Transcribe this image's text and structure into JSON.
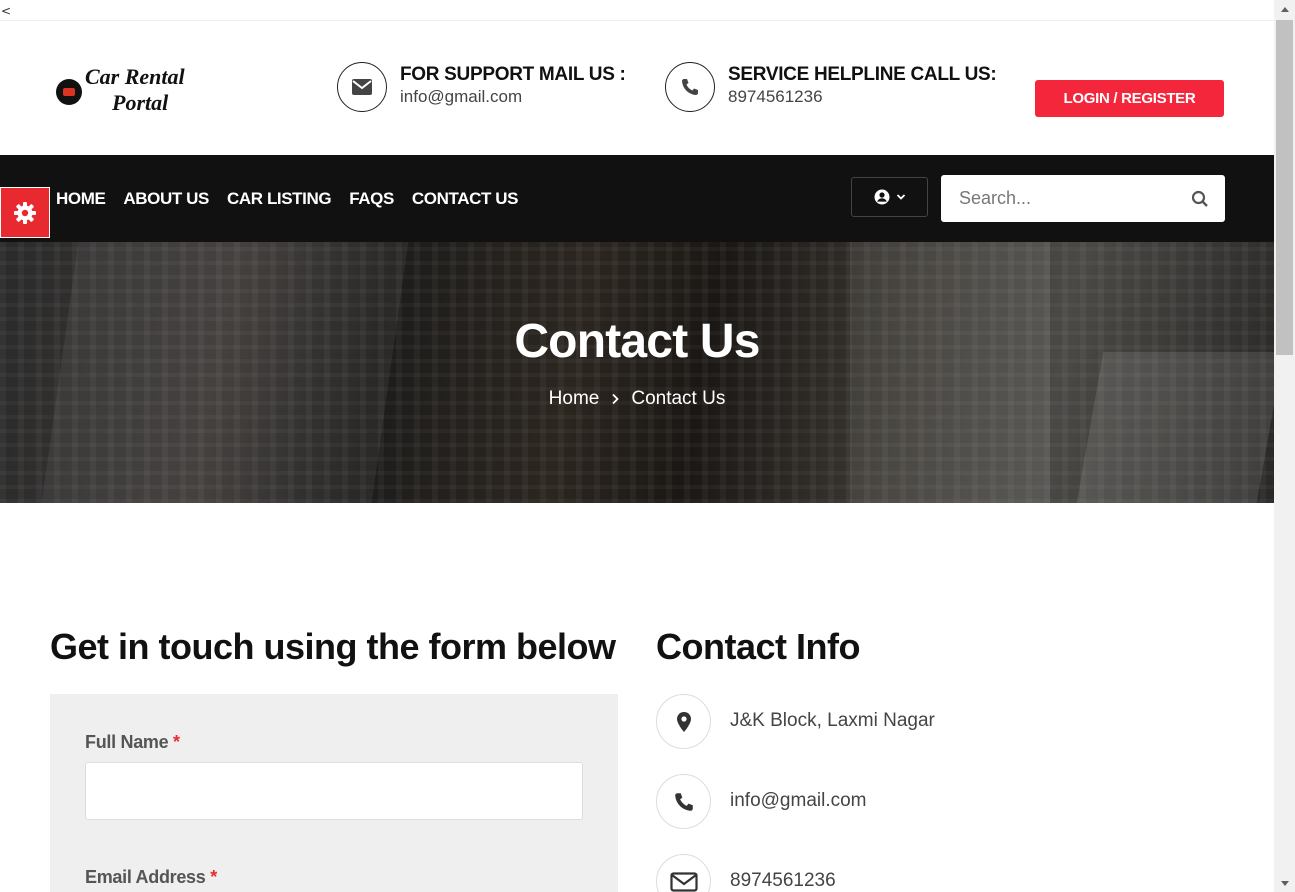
{
  "stray_char": "<",
  "logo": {
    "line1": "Car Rental",
    "line2": "Portal"
  },
  "header": {
    "mail": {
      "title": "FOR SUPPORT MAIL US :",
      "value": "info@gmail.com",
      "icon": "envelope-icon"
    },
    "phone": {
      "title": "SERVICE HELPLINE CALL US:",
      "value": "8974561236",
      "icon": "phone-icon"
    },
    "login_label": "LOGIN / REGISTER"
  },
  "nav": {
    "items": [
      {
        "label": "HOME"
      },
      {
        "label": "ABOUT US"
      },
      {
        "label": "CAR LISTING"
      },
      {
        "label": "FAQS"
      },
      {
        "label": "CONTACT US"
      }
    ],
    "search_placeholder": "Search..."
  },
  "hero": {
    "title": "Contact Us",
    "breadcrumb": {
      "home": "Home",
      "current": "Contact Us"
    }
  },
  "form": {
    "heading": "Get in touch using the form below",
    "full_name_label": "Full Name",
    "email_label": "Email Address",
    "required_mark": "*",
    "full_name_value": ""
  },
  "info": {
    "heading": "Contact Info",
    "items": [
      {
        "icon": "map-marker-icon",
        "text": "J&K Block, Laxmi Nagar"
      },
      {
        "icon": "phone-icon",
        "text": "info@gmail.com"
      },
      {
        "icon": "envelope-icon",
        "text": "8974561236"
      }
    ]
  },
  "colors": {
    "accent": "#f3263b",
    "nav_bg": "#111111",
    "gear_tab": "#e82a30"
  }
}
